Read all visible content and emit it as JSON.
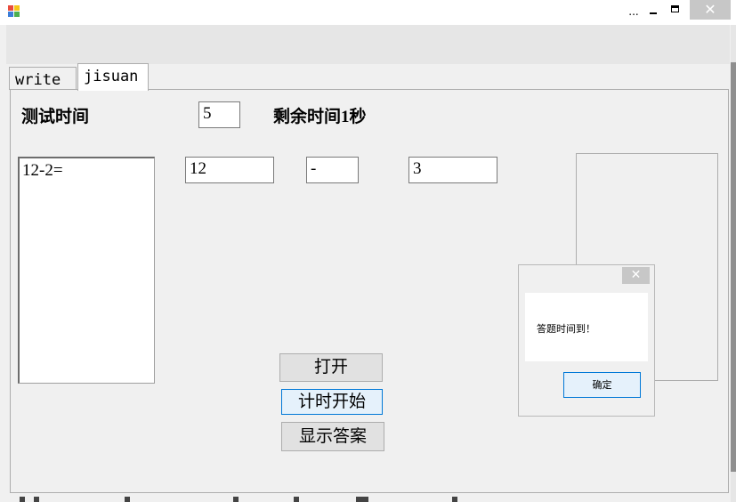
{
  "window": {
    "overflow_label": "...",
    "close_symbol": "✕"
  },
  "tabs": [
    {
      "label": "write"
    },
    {
      "label": "jisuan"
    }
  ],
  "test_time": {
    "label": "测试时间",
    "value": "5"
  },
  "remaining_label": "剩余时间1秒",
  "questions_list": {
    "text": "12-2="
  },
  "operand1": "12",
  "operator": "-",
  "operand2": "3",
  "buttons": {
    "open": "打开",
    "start_timer": "计时开始",
    "show_answer": "显示答案"
  },
  "message_box": {
    "close_symbol": "✕",
    "text": "答题时间到！",
    "ok": "确定"
  }
}
